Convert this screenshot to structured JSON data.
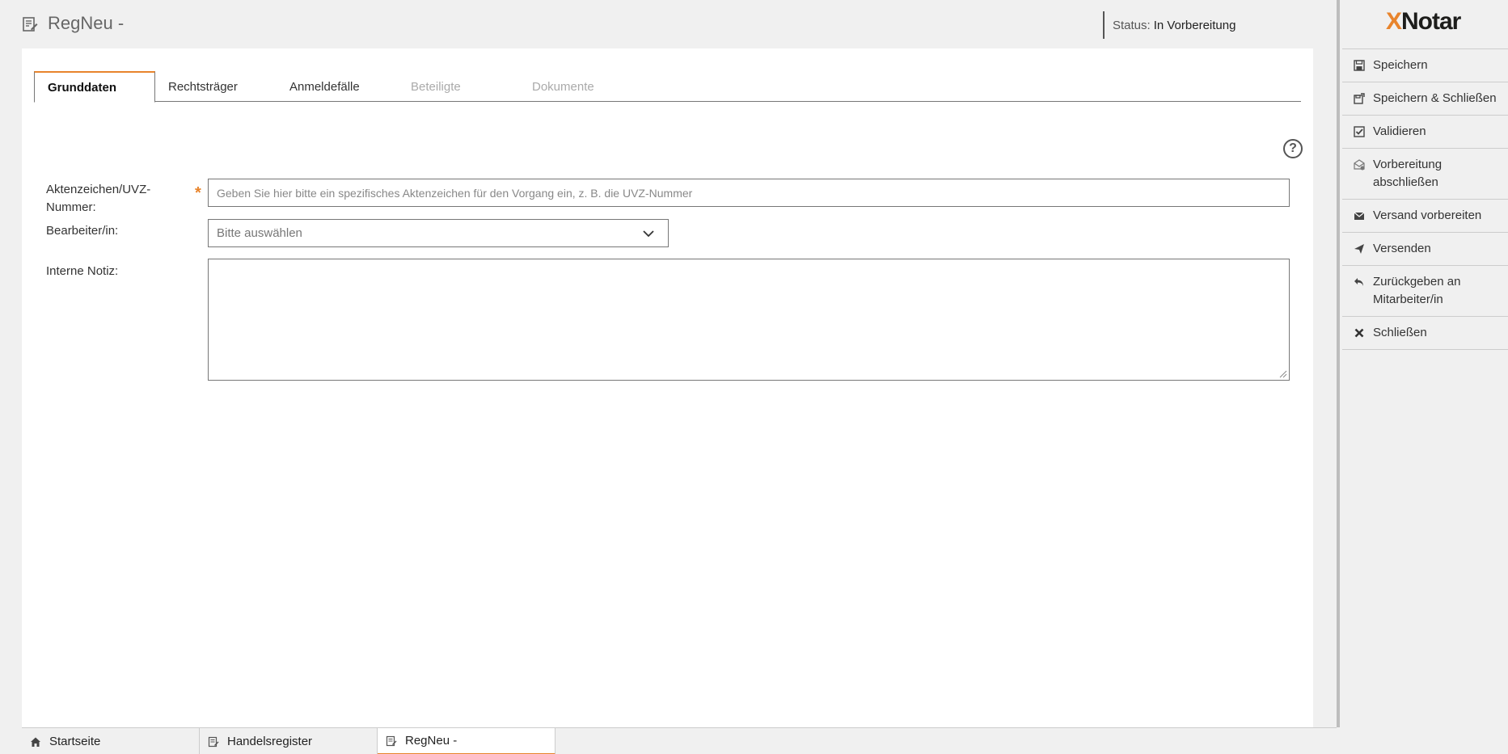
{
  "header": {
    "title": "RegNeu -",
    "status_label": "Status:",
    "status_value": "In Vorbereitung"
  },
  "tabs": [
    {
      "label": "Grunddaten",
      "state": "active"
    },
    {
      "label": "Rechtsträger",
      "state": "enabled"
    },
    {
      "label": "Anmeldefälle",
      "state": "enabled"
    },
    {
      "label": "Beteiligte",
      "state": "disabled"
    },
    {
      "label": "Dokumente",
      "state": "disabled"
    }
  ],
  "form": {
    "aktenzeichen_label_1": "Aktenzeichen/UVZ-",
    "aktenzeichen_label_2": "Nummer:",
    "aktenzeichen_required": "*",
    "aktenzeichen_placeholder": "Geben Sie hier bitte ein spezifisches Aktenzeichen für den Vorgang ein, z. B. die UVZ-Nummer",
    "aktenzeichen_value": "",
    "bearbeiter_label": "Bearbeiter/in:",
    "bearbeiter_selected": "Bitte auswählen",
    "notiz_label": "Interne Notiz:",
    "notiz_value": "",
    "help_symbol": "?"
  },
  "logo": {
    "x": "X",
    "rest": "Notar"
  },
  "sidebar": {
    "items": [
      {
        "label": "Speichern",
        "icon": "save-icon"
      },
      {
        "label": "Speichern & Schließen",
        "icon": "save-close-icon"
      },
      {
        "label": "Validieren",
        "icon": "check-icon"
      },
      {
        "label": "Vorbereitung abschließen",
        "icon": "envelope-lock-icon"
      },
      {
        "label": "Versand vorbereiten",
        "icon": "envelope-icon"
      },
      {
        "label": "Versenden",
        "icon": "send-icon"
      },
      {
        "label": "Zurückgeben an Mitarbeiter/in",
        "icon": "reply-icon"
      },
      {
        "label": "Schließen",
        "icon": "close-icon"
      }
    ]
  },
  "taskbar": {
    "items": [
      {
        "label": "Startseite",
        "icon": "home-icon"
      },
      {
        "label": "Handelsregister",
        "icon": "document-icon"
      },
      {
        "label": "RegNeu -",
        "icon": "document-icon",
        "active": true
      }
    ]
  },
  "colors": {
    "accent": "#e8842c",
    "background": "#f0f0f0",
    "panel": "#ffffff"
  }
}
